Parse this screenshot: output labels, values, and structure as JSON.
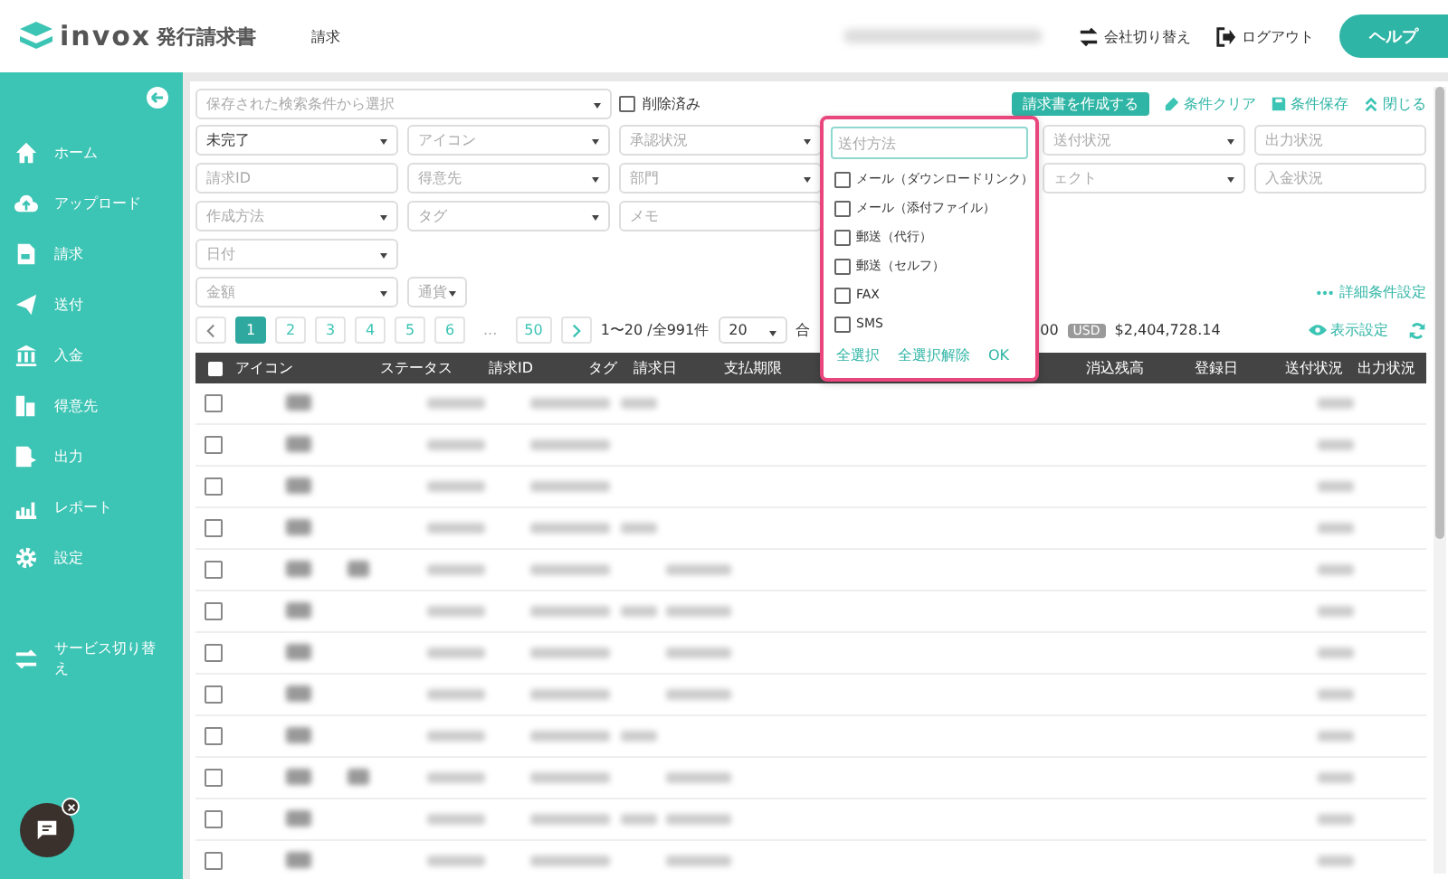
{
  "header": {
    "brand": "invox",
    "product": "発行請求書",
    "nav": "請求",
    "company_switch": "会社切り替え",
    "logout": "ログアウト",
    "help": "ヘルプ"
  },
  "sidebar": {
    "items": [
      {
        "label": "ホーム"
      },
      {
        "label": "アップロード"
      },
      {
        "label": "請求"
      },
      {
        "label": "送付"
      },
      {
        "label": "入金"
      },
      {
        "label": "得意先"
      },
      {
        "label": "出力"
      },
      {
        "label": "レポート"
      },
      {
        "label": "設定"
      }
    ],
    "service_switch": "サービス切り替え"
  },
  "filters": {
    "saved_search": "保存された検索条件から選択",
    "deleted": {
      "label": "削除済み",
      "checked": false
    },
    "create_button": "請求書を作成する",
    "clear": "条件クリア",
    "save": "条件保存",
    "close": "閉じる",
    "advanced": "詳細条件設定",
    "fields": [
      {
        "kind": "select",
        "value": "未完了"
      },
      {
        "kind": "select",
        "placeholder": "アイコン"
      },
      {
        "kind": "select",
        "placeholder": "承認状況"
      },
      {
        "kind": "hidden"
      },
      {
        "kind": "select",
        "placeholder": "送付状況"
      },
      {
        "kind": "text",
        "placeholder": "出力状況"
      },
      {
        "kind": "text",
        "placeholder": "請求ID"
      },
      {
        "kind": "select",
        "placeholder": "得意先"
      },
      {
        "kind": "select",
        "placeholder": "部門"
      },
      {
        "kind": "hidden"
      },
      {
        "kind": "select",
        "placeholder": "ェクト"
      },
      {
        "kind": "text",
        "placeholder": "入金状況"
      },
      {
        "kind": "select",
        "placeholder": "作成方法"
      },
      {
        "kind": "select",
        "placeholder": "タグ"
      },
      {
        "kind": "text",
        "placeholder": "メモ"
      },
      {
        "kind": "hidden"
      },
      {
        "kind": "empty"
      },
      {
        "kind": "empty"
      },
      {
        "kind": "select",
        "placeholder": "日付"
      },
      {
        "kind": "empty"
      },
      {
        "kind": "empty"
      },
      {
        "kind": "empty"
      },
      {
        "kind": "empty"
      },
      {
        "kind": "empty"
      }
    ],
    "amount": "金額",
    "currency": "通貨"
  },
  "dropdown": {
    "placeholder": "送付方法",
    "options": [
      {
        "label": "メール（ダウンロードリンク）",
        "checked": false
      },
      {
        "label": "メール（添付ファイル）",
        "checked": false
      },
      {
        "label": "郵送（代行）",
        "checked": false
      },
      {
        "label": "郵送（セルフ）",
        "checked": false
      },
      {
        "label": "FAX",
        "checked": false
      },
      {
        "label": "SMS",
        "checked": false
      }
    ],
    "select_all": "全選択",
    "deselect_all": "全選択解除",
    "ok": "OK"
  },
  "pagination": {
    "pages": [
      {
        "label": "1",
        "selected": true
      },
      {
        "label": "2",
        "selected": false
      },
      {
        "label": "3",
        "selected": false
      },
      {
        "label": "4",
        "selected": false
      },
      {
        "label": "5",
        "selected": false
      },
      {
        "label": "6",
        "selected": false
      },
      {
        "label": "...",
        "selected": false
      },
      {
        "label": "50",
        "selected": false
      }
    ],
    "range": "1〜20 /全991件",
    "per_page": "20",
    "total_fragment": "合",
    "amount_fragment": "00",
    "currency_badge": "USD",
    "usd_total": "$2,404,728.14",
    "display_settings": "表示設定"
  },
  "table": {
    "all_checked": false,
    "columns": [
      "アイコン",
      "ステータス",
      "請求ID",
      "タグ",
      "請求日",
      "支払期限",
      "",
      "",
      "",
      "消込残高",
      "登録日",
      "送付状況",
      "出力状況"
    ],
    "rows": [
      {
        "checked": false
      },
      {
        "checked": false
      },
      {
        "checked": false
      },
      {
        "checked": false
      },
      {
        "checked": false
      },
      {
        "checked": false
      },
      {
        "checked": false
      },
      {
        "checked": false
      },
      {
        "checked": false
      },
      {
        "checked": false
      },
      {
        "checked": false
      },
      {
        "checked": false
      }
    ]
  }
}
